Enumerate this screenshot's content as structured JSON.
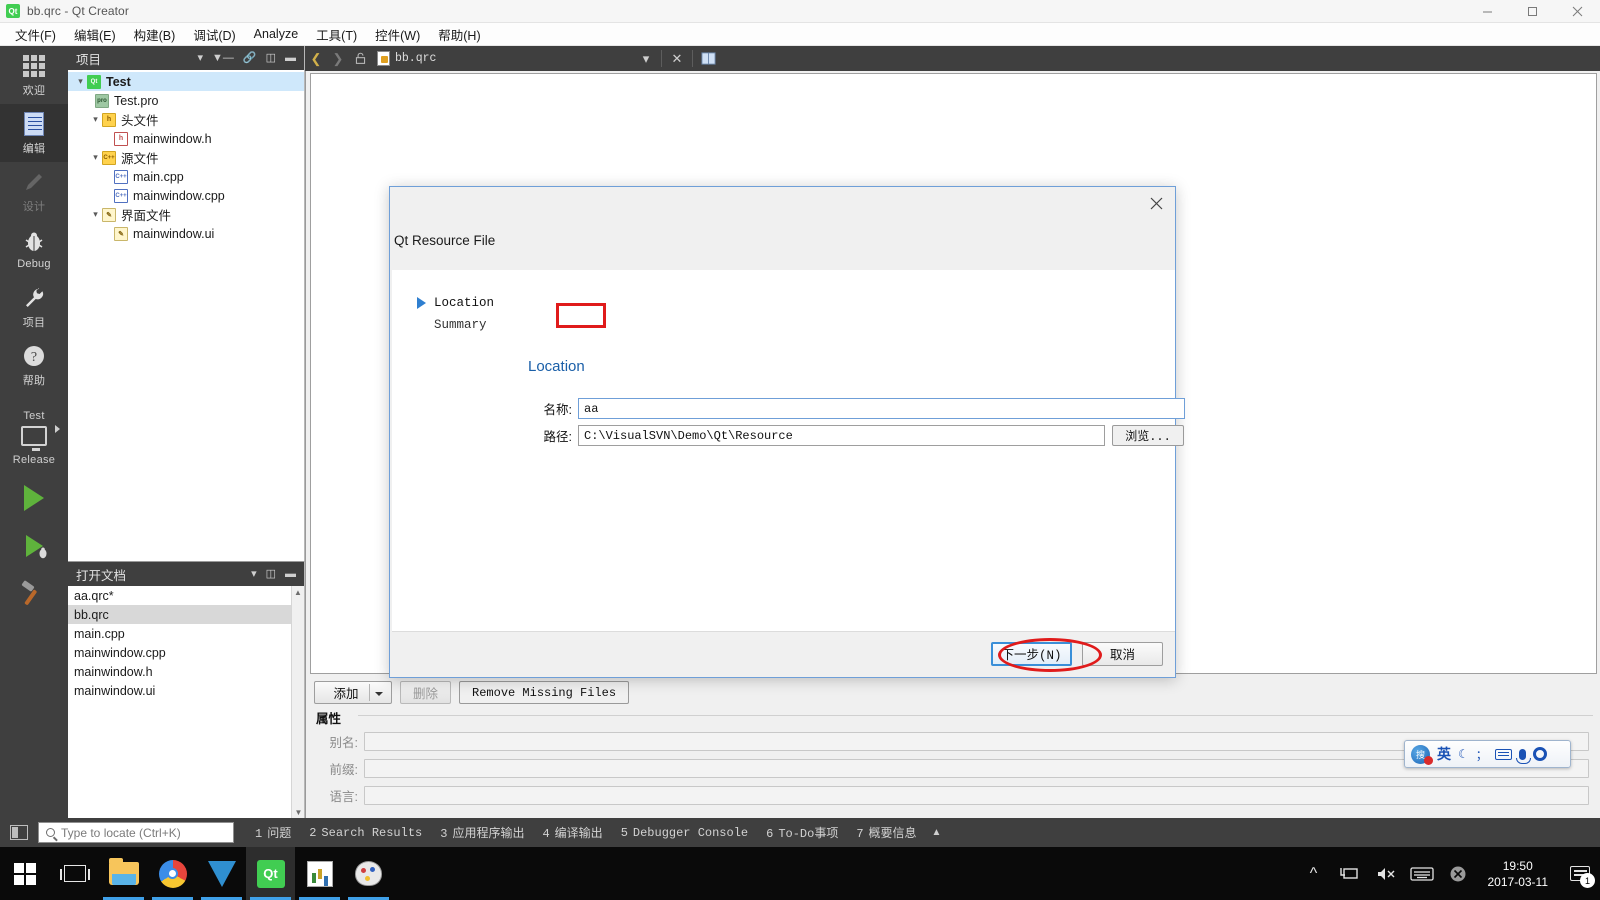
{
  "window": {
    "title": "bb.qrc - Qt Creator",
    "app_icon": "qt-icon",
    "minimize": "minimize-icon",
    "maximize": "maximize-icon",
    "close": "close-icon"
  },
  "menubar": [
    {
      "label": "文件(F)"
    },
    {
      "label": "编辑(E)"
    },
    {
      "label": "构建(B)"
    },
    {
      "label": "调试(D)"
    },
    {
      "label": "Analyze"
    },
    {
      "label": "工具(T)"
    },
    {
      "label": "控件(W)"
    },
    {
      "label": "帮助(H)"
    }
  ],
  "modebar": {
    "items": [
      {
        "label": "欢迎",
        "icon": "grid-icon",
        "active": false,
        "disabled": false
      },
      {
        "label": "编辑",
        "icon": "document-icon",
        "active": true,
        "disabled": false
      },
      {
        "label": "设计",
        "icon": "pencil-icon",
        "active": false,
        "disabled": true
      },
      {
        "label": "Debug",
        "icon": "bug-icon",
        "active": false,
        "disabled": false
      },
      {
        "label": "项目",
        "icon": "wrench-icon",
        "active": false,
        "disabled": false
      },
      {
        "label": "帮助",
        "icon": "help-icon",
        "active": false,
        "disabled": false
      }
    ],
    "kit": {
      "project": "Test",
      "build_config": "Release"
    }
  },
  "project_panel": {
    "title": "项目",
    "tools": [
      "filter-icon",
      "link-icon",
      "split-icon",
      "close-panel-icon"
    ],
    "tree": [
      {
        "label": "Test",
        "indent": 0,
        "chevron": "down",
        "icon": "qt-project-icon",
        "bold": true,
        "selected": true
      },
      {
        "label": "Test.pro",
        "indent": 1,
        "chevron": "",
        "icon": "pro-file-icon",
        "bold": false,
        "selected": false
      },
      {
        "label": "头文件",
        "indent": 1,
        "chevron": "down",
        "icon": "folder-h-icon",
        "bold": false,
        "selected": false
      },
      {
        "label": "mainwindow.h",
        "indent": 2,
        "chevron": "",
        "icon": "h-file-icon",
        "bold": false,
        "selected": false
      },
      {
        "label": "源文件",
        "indent": 1,
        "chevron": "down",
        "icon": "folder-cpp-icon",
        "bold": false,
        "selected": false
      },
      {
        "label": "main.cpp",
        "indent": 2,
        "chevron": "",
        "icon": "cpp-file-icon",
        "bold": false,
        "selected": false
      },
      {
        "label": "mainwindow.cpp",
        "indent": 2,
        "chevron": "",
        "icon": "cpp-file-icon",
        "bold": false,
        "selected": false
      },
      {
        "label": "界面文件",
        "indent": 1,
        "chevron": "down",
        "icon": "folder-ui-icon",
        "bold": false,
        "selected": false
      },
      {
        "label": "mainwindow.ui",
        "indent": 2,
        "chevron": "",
        "icon": "ui-file-icon",
        "bold": false,
        "selected": false
      }
    ]
  },
  "open_documents": {
    "title": "打开文档",
    "items": [
      {
        "label": "aa.qrc*",
        "selected": false
      },
      {
        "label": "bb.qrc",
        "selected": true
      },
      {
        "label": "main.cpp",
        "selected": false
      },
      {
        "label": "mainwindow.cpp",
        "selected": false
      },
      {
        "label": "mainwindow.h",
        "selected": false
      },
      {
        "label": "mainwindow.ui",
        "selected": false
      }
    ]
  },
  "editor_toolbar": {
    "back": "nav-back-icon",
    "forward": "nav-forward-icon",
    "unlock": "unlock-icon",
    "file_icon": "qrc-file-icon",
    "filename": "bb.qrc",
    "dropdown": "chevron-down-icon",
    "close": "close-editor-icon",
    "split": "split-editor-icon",
    "split_right": "split-right-icon"
  },
  "resource_editor": {
    "add_button": "添加",
    "remove_button": "删除",
    "remove_missing_button": "Remove Missing Files",
    "properties_title": "属性",
    "properties": [
      {
        "label": "别名:",
        "value": ""
      },
      {
        "label": "前缀:",
        "value": ""
      },
      {
        "label": "语言:",
        "value": ""
      }
    ]
  },
  "dialog": {
    "title_text": "Qt Resource File",
    "close_icon": "close-icon",
    "steps": [
      {
        "label": "Location",
        "active": true
      },
      {
        "label": "Summary",
        "active": false
      }
    ],
    "section_title": "Location",
    "fields": [
      {
        "label": "名称:",
        "value": "aa",
        "highlighted": true
      },
      {
        "label": "路径:",
        "value": "C:\\VisualSVN\\Demo\\Qt\\Resource",
        "highlighted": false
      }
    ],
    "browse_button": "浏览...",
    "next_button": "下一步(N)",
    "cancel_button": "取消"
  },
  "locator": {
    "sidebar_toggle": "sidebar-toggle-icon",
    "search_icon": "search-icon",
    "placeholder": "Type to locate (Ctrl+K)",
    "output_tabs": [
      {
        "num": "1",
        "label": "问题"
      },
      {
        "num": "2",
        "label": "Search Results"
      },
      {
        "num": "3",
        "label": "应用程序输出"
      },
      {
        "num": "4",
        "label": "编译输出"
      },
      {
        "num": "5",
        "label": "Debugger Console"
      },
      {
        "num": "6",
        "label": "To-Do事项"
      },
      {
        "num": "7",
        "label": "概要信息"
      }
    ],
    "expand_icon": "chevron-up-icon"
  },
  "ime_bar": {
    "logo": "sogou-logo-icon",
    "mode": "英",
    "moon": "moon-icon",
    "punct": "punctuation-icon",
    "keyboard": "keyboard-icon",
    "mic": "microphone-icon",
    "settings": "gear-icon"
  },
  "taskbar": {
    "start": "windows-start-icon",
    "task_view": "task-view-icon",
    "apps": [
      {
        "name": "file-explorer-icon",
        "running": true,
        "active": false
      },
      {
        "name": "chrome-icon",
        "running": true,
        "active": false
      },
      {
        "name": "tornado-app-icon",
        "running": true,
        "active": false
      },
      {
        "name": "qt-creator-icon",
        "running": true,
        "active": true
      },
      {
        "name": "chart-app-icon",
        "running": true,
        "active": false
      },
      {
        "name": "paint-app-icon",
        "running": true,
        "active": false
      }
    ],
    "tray": {
      "show_hidden": "chevron-up-icon",
      "network": "network-icon",
      "volume": "volume-muted-icon",
      "keyboard": "keyboard-icon",
      "security": "security-alert-icon",
      "time": "19:50",
      "date": "2017-03-11",
      "notifications": "notification-icon",
      "notification_count": "1"
    }
  },
  "colors": {
    "accent": "#3a8fd8",
    "annotation_red": "#e01b1b",
    "mode_bar": "#3f3f3f",
    "qt_green": "#41cd52",
    "link_blue": "#1a5fa8"
  }
}
